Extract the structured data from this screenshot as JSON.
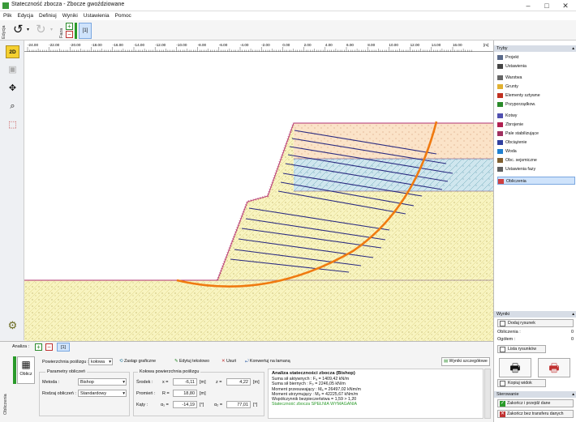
{
  "window": {
    "title": "Stateczność zbocza - Zbocze gwoździowane"
  },
  "menu": [
    "Plik",
    "Edycja",
    "Definiuj",
    "Wyniki",
    "Ustawienia",
    "Pomoc"
  ],
  "toolbar": {
    "side_label": "Edycja",
    "stage_side_label": "Faza",
    "stage_number": "[1]"
  },
  "lefttools": {
    "mode_2d": "2D"
  },
  "ruler": {
    "ticks": [
      "-24.00",
      "-22.00",
      "-20.00",
      "-18.00",
      "-16.00",
      "-14.00",
      "-12.00",
      "-10.00",
      "-8.00",
      "-6.00",
      "-4.00",
      "-2.00",
      "0.00",
      "2.00",
      "4.00",
      "6.00",
      "8.00",
      "10.00",
      "12.00",
      "14.00",
      "16.00"
    ],
    "unit": "[m]"
  },
  "right_panel": {
    "tryby_header": "Tryby",
    "items": [
      {
        "label": "Projekt",
        "icon": "project-icon",
        "color": "#5a6a8a"
      },
      {
        "label": "Ustawienia",
        "icon": "settings-icon",
        "color": "#444"
      },
      {
        "label": "Warstwa",
        "icon": "layer-icon",
        "color": "#666"
      },
      {
        "label": "Grunty",
        "icon": "soils-icon",
        "color": "#e0b030"
      },
      {
        "label": "Elementy sztywne",
        "icon": "rigid-elements-icon",
        "color": "#c03020"
      },
      {
        "label": "Przyporządkow.",
        "icon": "assign-icon",
        "color": "#2a8a2a"
      },
      {
        "label": "Kotwy",
        "icon": "anchors-icon",
        "color": "#5050b0"
      },
      {
        "label": "Zbrojenie",
        "icon": "reinforcement-icon",
        "color": "#b02050"
      },
      {
        "label": "Pale stabilizujące",
        "icon": "piles-icon",
        "color": "#a03060"
      },
      {
        "label": "Obciążenie",
        "icon": "load-icon",
        "color": "#3040a0"
      },
      {
        "label": "Woda",
        "icon": "water-icon",
        "color": "#2080d0"
      },
      {
        "label": "Obc. sejsmiczne",
        "icon": "seismic-icon",
        "color": "#806030"
      },
      {
        "label": "Ustawienia fazy",
        "icon": "stage-settings-icon",
        "color": "#606060"
      },
      {
        "label": "Obliczenia",
        "icon": "calculation-icon",
        "color": "#d04040"
      }
    ],
    "wyniki_header": "Wyniki",
    "add_drawing": "Dodaj rysunek",
    "obliczenia_label": "Obliczenia :",
    "obliczenia_value": "0",
    "ogolem_label": "Ogółem :",
    "ogolem_value": "0",
    "drawing_list": "Lista rysunków",
    "copy_view": "Kopiuj widok",
    "sterowanie_header": "Sterowanie",
    "finish_btn": "Zakończ i przejdź dane",
    "finish_no_transfer": "Zakończ bez transferu danych"
  },
  "bottom": {
    "side_label": "Obliczenia",
    "analysis_label": "Analiza :",
    "analysis_number": "[1]",
    "calc_button": "Oblicz",
    "slip_surface_label": "Powierzchnia poślizgu :",
    "slip_surface_value": "kołowa",
    "replace_graphics": "Zastąp graficzne",
    "edit_text": "Edytuj tekstowo",
    "delete": "Usuń",
    "convert": "Konwertuj na łamaną",
    "detailed_results": "Wyniki szczegółowe",
    "params_title": "Parametry obliczeń",
    "method_label": "Metoda :",
    "method_value": "Bishop",
    "calc_type_label": "Rodzaj obliczeń :",
    "calc_type_value": "Standardowy",
    "circle_title": "Kołowa powierzchnia poślizgu",
    "center_label": "Środek :",
    "x_label": "x =",
    "x_value": "-6,11",
    "z_label": "z =",
    "z_value": "4,22",
    "unit_m": "[m]",
    "radius_label": "Promień :",
    "r_label": "R =",
    "r_value": "18,80",
    "angles_label": "Kąty :",
    "a1_label": "α₁ =",
    "a1_value": "-14,19",
    "a2_label": "α₂ =",
    "a2_value": "77,01",
    "unit_deg": "[°]"
  },
  "results": {
    "title": "Analiza stateczności zbocza (Bishop)",
    "lines": [
      "Suma sił aktywnych :    Fₐ =   1409,42 kN/m",
      "Suma sił biernych :      Fₚ =   2246,05 kN/m",
      "Moment przesuwający :  Mₐ =  26497,02 kNm/m",
      "Moment utrzymujący :   Mₚ =  42225,67 kNm/m",
      "Współczynnik bezpieczeństwa = 1,59 > 1,20"
    ],
    "verdict": "Stateczność zbocza SPEŁNIA WYMAGANIA",
    "verdict_color": "#2a9a2a"
  },
  "colors": {
    "accent": "#2a7a2a",
    "selection": "#cfe3fb",
    "slip_circle": "#f07a10",
    "anchor": "#2a2a80"
  }
}
